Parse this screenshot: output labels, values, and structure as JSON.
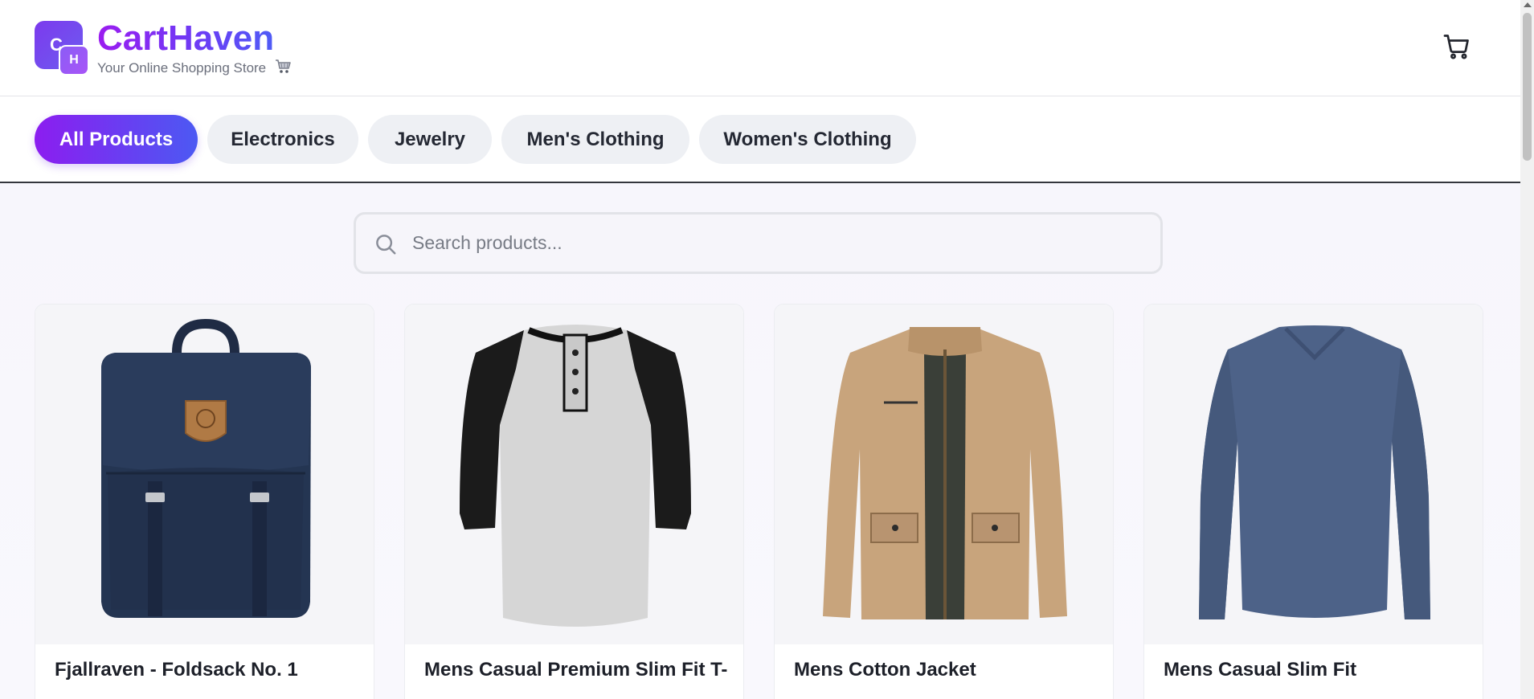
{
  "brand": {
    "logo_letter_primary": "C",
    "logo_letter_secondary": "H",
    "name": "CartHaven",
    "tagline": "Your Online Shopping Store"
  },
  "header": {
    "cart_icon": "shopping-cart-icon"
  },
  "categories": [
    {
      "label": "All Products",
      "active": true
    },
    {
      "label": "Electronics",
      "active": false
    },
    {
      "label": "Jewelry",
      "active": false
    },
    {
      "label": "Men's Clothing",
      "active": false
    },
    {
      "label": "Women's Clothing",
      "active": false
    }
  ],
  "search": {
    "placeholder": "Search products...",
    "value": "",
    "icon": "search-icon"
  },
  "products": [
    {
      "title": "Fjallraven - Foldsack No. 1",
      "image_icon": "backpack-image"
    },
    {
      "title": "Mens Casual Premium Slim Fit T-",
      "image_icon": "raglan-henley-tshirt-image"
    },
    {
      "title": "Mens Cotton Jacket",
      "image_icon": "cotton-jacket-image"
    },
    {
      "title": "Mens Casual Slim Fit",
      "image_icon": "long-sleeve-tshirt-image"
    }
  ],
  "colors": {
    "brand_gradient_start": "#9b1cf0",
    "brand_gradient_end": "#4f5bf6",
    "tab_inactive_bg": "#eef0f4",
    "page_bg": "#f7f6fc"
  }
}
